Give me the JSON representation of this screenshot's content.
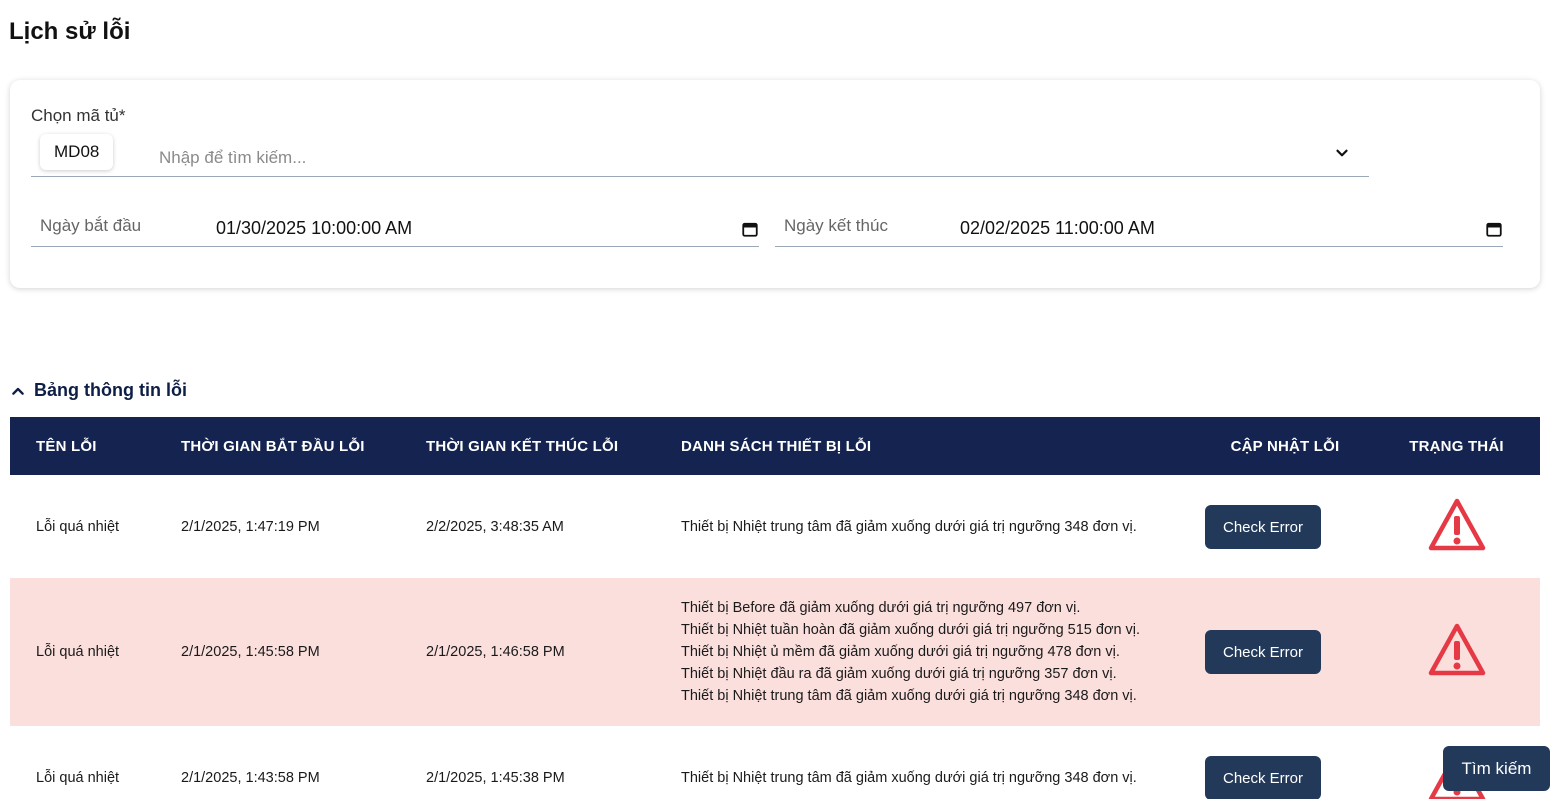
{
  "page": {
    "title": "Lịch sử lỗi"
  },
  "filters": {
    "cabinet_label": "Chọn mã tủ*",
    "selected_cabinet": "MD08",
    "search_placeholder": "Nhập để tìm kiếm...",
    "start_label": "Ngày bắt đầu",
    "start_value": "01/30/2025 10:00:00 AM",
    "end_label": "Ngày kết thúc",
    "end_value": "02/02/2025 11:00:00 AM"
  },
  "table": {
    "section_title": "Bảng thông tin lỗi",
    "headers": {
      "name": "TÊN LỖI",
      "start": "THỜI GIAN BẮT ĐẦU LỖI",
      "end": "THỜI GIAN KẾT THÚC LỖI",
      "devices": "DANH SÁCH THIẾT BỊ LỖI",
      "update": "CẬP NHẬT LỖI",
      "status": "TRẠNG THÁI"
    },
    "rows": [
      {
        "name": "Lỗi quá nhiệt",
        "start": "2/1/2025, 1:47:19 PM",
        "end": "2/2/2025, 3:48:35 AM",
        "devices": [
          "Thiết bị Nhiệt trung tâm đã giảm xuống dưới giá trị ngưỡng 348 đơn vị."
        ],
        "button": "Check Error",
        "status_icon": "warning-triangle-icon",
        "highlight": false
      },
      {
        "name": "Lỗi quá nhiệt",
        "start": "2/1/2025, 1:45:58 PM",
        "end": "2/1/2025, 1:46:58 PM",
        "devices": [
          "Thiết bị Before đã giảm xuống dưới giá trị ngưỡng 497 đơn vị.",
          "Thiết bị Nhiệt tuần hoàn đã giảm xuống dưới giá trị ngưỡng 515 đơn vị.",
          "Thiết bị Nhiệt ủ mềm đã giảm xuống dưới giá trị ngưỡng 478 đơn vị.",
          "Thiết bị Nhiệt đầu ra đã giảm xuống dưới giá trị ngưỡng 357 đơn vị.",
          "Thiết bị Nhiệt trung tâm đã giảm xuống dưới giá trị ngưỡng 348 đơn vị."
        ],
        "button": "Check Error",
        "status_icon": "warning-triangle-icon",
        "highlight": true
      },
      {
        "name": "Lỗi quá nhiệt",
        "start": "2/1/2025, 1:43:58 PM",
        "end": "2/1/2025, 1:45:38 PM",
        "devices": [
          "Thiết bị Nhiệt trung tâm đã giảm xuống dưới giá trị ngưỡng 348 đơn vị."
        ],
        "button": "Check Error",
        "status_icon": "warning-triangle-icon",
        "highlight": false
      }
    ]
  },
  "search_button": "Tìm kiếm",
  "colors": {
    "header_bg": "#14234f",
    "alert_row_bg": "#fbdfdd",
    "button_bg": "#22395a",
    "warning_red": "#e53945"
  }
}
